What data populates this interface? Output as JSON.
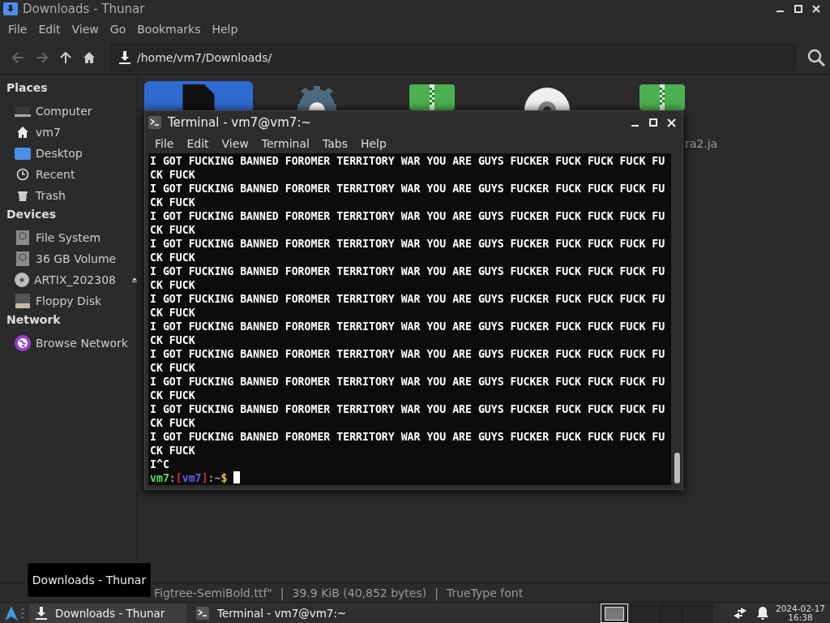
{
  "thunar": {
    "title": "Downloads - Thunar",
    "menu": [
      "File",
      "Edit",
      "View",
      "Go",
      "Bookmarks",
      "Help"
    ],
    "path": "/home/vm7/Downloads/",
    "sidebar": [
      {
        "heading": "Places",
        "items": [
          {
            "label": "Computer",
            "kind": "computer",
            "selected": false
          },
          {
            "label": "vm7",
            "kind": "home",
            "selected": false
          },
          {
            "label": "Desktop",
            "kind": "desktop",
            "selected": false
          },
          {
            "label": "Recent",
            "kind": "recent",
            "selected": false
          },
          {
            "label": "Trash",
            "kind": "trash",
            "selected": false
          }
        ]
      },
      {
        "heading": "Devices",
        "items": [
          {
            "label": "File System",
            "kind": "drive",
            "selected": false
          },
          {
            "label": "36 GB Volume",
            "kind": "drive",
            "selected": false
          },
          {
            "label": "ARTIX_202308",
            "kind": "disc",
            "selected": false,
            "eject": true
          },
          {
            "label": "Floppy Disk",
            "kind": "floppy",
            "selected": false
          }
        ]
      },
      {
        "heading": "Network",
        "items": [
          {
            "label": "Browse Network",
            "kind": "network",
            "selected": false
          }
        ]
      }
    ],
    "files": [
      {
        "kind": "document",
        "selected": true
      },
      {
        "kind": "settings",
        "selected": false
      },
      {
        "kind": "archive",
        "selected": false
      },
      {
        "kind": "disc",
        "selected": false
      },
      {
        "kind": "archive",
        "selected": false,
        "label": "ra2.ja"
      }
    ],
    "status": [
      "Figtree-SemiBold.ttf\"",
      "|",
      "39.9 KiB (40,852 bytes)",
      "|",
      "TrueType font"
    ]
  },
  "terminal": {
    "title": "Terminal - vm7@vm7:~",
    "menu": [
      "File",
      "Edit",
      "View",
      "Terminal",
      "Tabs",
      "Help"
    ],
    "lines": [
      "I GOT FUCKING BANNED FOROMER TERRITORY WAR YOU ARE GUYS FUCKER FUCK FUCK FUCK FU",
      "CK FUCK",
      "I GOT FUCKING BANNED FOROMER TERRITORY WAR YOU ARE GUYS FUCKER FUCK FUCK FUCK FU",
      "CK FUCK",
      "I GOT FUCKING BANNED FOROMER TERRITORY WAR YOU ARE GUYS FUCKER FUCK FUCK FUCK FU",
      "CK FUCK",
      "I GOT FUCKING BANNED FOROMER TERRITORY WAR YOU ARE GUYS FUCKER FUCK FUCK FUCK FU",
      "CK FUCK",
      "I GOT FUCKING BANNED FOROMER TERRITORY WAR YOU ARE GUYS FUCKER FUCK FUCK FUCK FU",
      "CK FUCK",
      "I GOT FUCKING BANNED FOROMER TERRITORY WAR YOU ARE GUYS FUCKER FUCK FUCK FUCK FU",
      "CK FUCK",
      "I GOT FUCKING BANNED FOROMER TERRITORY WAR YOU ARE GUYS FUCKER FUCK FUCK FUCK FU",
      "CK FUCK",
      "I GOT FUCKING BANNED FOROMER TERRITORY WAR YOU ARE GUYS FUCKER FUCK FUCK FUCK FU",
      "CK FUCK",
      "I GOT FUCKING BANNED FOROMER TERRITORY WAR YOU ARE GUYS FUCKER FUCK FUCK FUCK FU",
      "CK FUCK",
      "I GOT FUCKING BANNED FOROMER TERRITORY WAR YOU ARE GUYS FUCKER FUCK FUCK FUCK FU",
      "CK FUCK",
      "I GOT FUCKING BANNED FOROMER TERRITORY WAR YOU ARE GUYS FUCKER FUCK FUCK FUCK FU",
      "CK FUCK",
      "I^C"
    ],
    "prompt": [
      {
        "text": "vm7",
        "color": "#5fd75f"
      },
      {
        "text": ":",
        "color": "#9a9a9a"
      },
      {
        "text": "[",
        "color": "#d03030"
      },
      {
        "text": "vm7",
        "color": "#6060e0"
      },
      {
        "text": "]",
        "color": "#d03030"
      },
      {
        "text": ":~",
        "color": "#9a9a9a"
      },
      {
        "text": "$",
        "color": "#e8d040"
      }
    ]
  },
  "tooltip": "Downloads - Thunar",
  "taskbar": {
    "tasks": [
      {
        "label": "Downloads - Thunar",
        "kind": "download",
        "selected": true
      },
      {
        "label": "Terminal - vm7@vm7:~",
        "kind": "terminal",
        "selected": false
      }
    ],
    "workspaces": [
      {
        "selected": true
      },
      {
        "selected": false
      },
      {
        "selected": false
      },
      {
        "selected": false
      }
    ],
    "date": "2024-02-17",
    "time": "16:38"
  }
}
